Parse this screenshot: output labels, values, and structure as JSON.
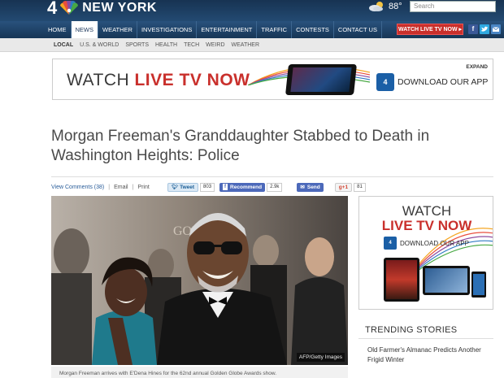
{
  "header": {
    "logo_number": "4",
    "logo_city": "NEW YORK",
    "weather_temp": "88°",
    "weather_icon": "partly-cloudy-icon",
    "search_placeholder": "Search"
  },
  "nav": {
    "items": [
      "HOME",
      "NEWS",
      "WEATHER",
      "INVESTIGATIONS",
      "ENTERTAINMENT",
      "TRAFFIC",
      "CONTESTS",
      "CONTACT US"
    ],
    "active": "NEWS",
    "watch_button": "WATCH LIVE TV NOW ▸"
  },
  "social": {
    "icons": [
      "facebook-icon",
      "twitter-icon",
      "email-icon"
    ],
    "colors": {
      "facebook": "#3b5998",
      "twitter": "#2fa9e1",
      "email": "#4a86c5"
    }
  },
  "subnav": {
    "items": [
      "LOCAL",
      "U.S. & WORLD",
      "SPORTS",
      "HEALTH",
      "TECH",
      "WEIRD",
      "WEATHER"
    ],
    "active": "LOCAL"
  },
  "banner_ad": {
    "watch": "WATCH ",
    "live": "LIVE TV NOW",
    "expand": "EXPAND",
    "app_badge": "4",
    "app_text": "DOWNLOAD OUR APP"
  },
  "article": {
    "headline": "Morgan Freeman's Granddaughter Stabbed to Death in Washington Heights: Police",
    "view_comments": "View Comments (38)",
    "email": "Email",
    "print": "Print",
    "tweet_label": "Tweet",
    "tweet_count": "803",
    "recommend_label": "Recommend",
    "recommend_count": "2.9k",
    "send_label": "Send",
    "gplus_label": "g+1",
    "gplus_count": "81",
    "photo_credit": "AFP/Getty Images",
    "caption": "Morgan Freeman arrives with E'Dena Hines for the 62nd annual Golden Globe Awards show."
  },
  "side_ad": {
    "watch": "WATCH",
    "live": "LIVE TV NOW",
    "app_badge": "4",
    "app_text": "DOWNLOAD OUR APP"
  },
  "trending": {
    "title": "TRENDING STORIES",
    "items": [
      "Old Farmer's Almanac Predicts Another Frigid Winter"
    ]
  },
  "colors": {
    "header_blue": "#1b3a5c",
    "accent_red": "#c9302c",
    "link_blue": "#2a5d9a"
  }
}
